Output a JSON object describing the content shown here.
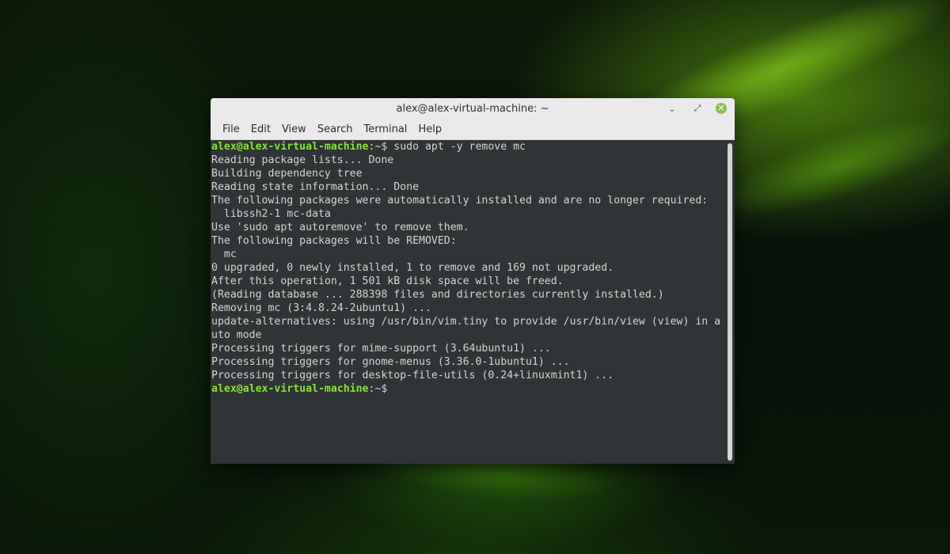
{
  "window": {
    "title": "alex@alex-virtual-machine: ~",
    "controls": {
      "minimize": "⌄",
      "maximize": "⤢",
      "close": "✕"
    }
  },
  "menu": [
    "File",
    "Edit",
    "View",
    "Search",
    "Terminal",
    "Help"
  ],
  "terminal": {
    "prompt_user": "alex@alex-virtual-machine",
    "prompt_sep": ":~$",
    "command": " sudo apt -y remove mc",
    "output": [
      "Reading package lists... Done",
      "Building dependency tree",
      "Reading state information... Done",
      "The following packages were automatically installed and are no longer required:",
      "  libssh2-1 mc-data",
      "Use 'sudo apt autoremove' to remove them.",
      "The following packages will be REMOVED:",
      "  mc",
      "0 upgraded, 0 newly installed, 1 to remove and 169 not upgraded.",
      "After this operation, 1 501 kB disk space will be freed.",
      "(Reading database ... 288398 files and directories currently installed.)",
      "Removing mc (3:4.8.24-2ubuntu1) ...",
      "update-alternatives: using /usr/bin/vim.tiny to provide /usr/bin/view (view) in a",
      "uto mode",
      "Processing triggers for mime-support (3.64ubuntu1) ...",
      "Processing triggers for gnome-menus (3.36.0-1ubuntu1) ...",
      "Processing triggers for desktop-file-utils (0.24+linuxmint1) ..."
    ],
    "final_prompt_user": "alex@alex-virtual-machine",
    "final_prompt_sep": ":~$"
  },
  "colors": {
    "prompt_user": "#8ae234",
    "terminal_bg": "#2f3436",
    "terminal_fg": "#d3d7cf",
    "close_button": "#8fbf4a"
  }
}
